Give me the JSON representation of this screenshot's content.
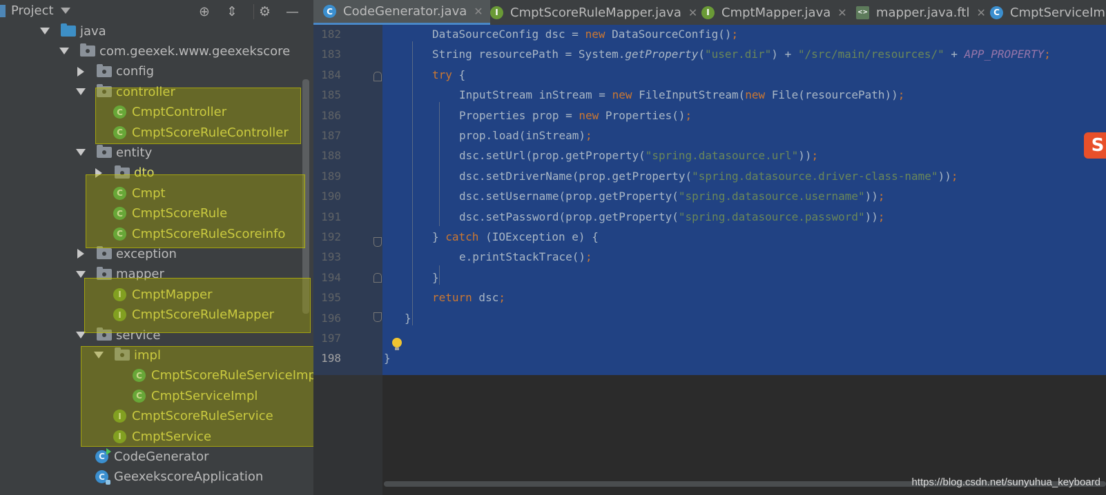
{
  "project": {
    "title": "Project",
    "toolbar_icons": [
      "target-icon",
      "collapse-icon",
      "gear-icon",
      "minimize-icon"
    ]
  },
  "tree": [
    {
      "label": "java",
      "level": 1,
      "kind": "folder-blue",
      "expanded": true
    },
    {
      "label": "com.geexek.www.geexekscore",
      "level": 2,
      "kind": "package",
      "expanded": true
    },
    {
      "label": "config",
      "level": 3,
      "kind": "package",
      "expanded": false
    },
    {
      "label": "controller",
      "level": 3,
      "kind": "package",
      "expanded": true,
      "hl": true
    },
    {
      "label": "CmptController",
      "level": 4,
      "kind": "class",
      "hl": true
    },
    {
      "label": "CmptScoreRuleController",
      "level": 4,
      "kind": "class",
      "hl": true
    },
    {
      "label": "entity",
      "level": 3,
      "kind": "package",
      "expanded": true
    },
    {
      "label": "dto",
      "level": 4,
      "kind": "package",
      "expanded": false,
      "hl": true
    },
    {
      "label": "Cmpt",
      "level": 4,
      "kind": "class",
      "hl": true
    },
    {
      "label": "CmptScoreRule",
      "level": 4,
      "kind": "class",
      "hl": true
    },
    {
      "label": "CmptScoreRuleScoreinfo",
      "level": 4,
      "kind": "class",
      "hl": true
    },
    {
      "label": "exception",
      "level": 3,
      "kind": "package",
      "expanded": false
    },
    {
      "label": "mapper",
      "level": 3,
      "kind": "package",
      "expanded": true
    },
    {
      "label": "CmptMapper",
      "level": 4,
      "kind": "interface",
      "hl": true
    },
    {
      "label": "CmptScoreRuleMapper",
      "level": 4,
      "kind": "interface",
      "hl": true
    },
    {
      "label": "service",
      "level": 3,
      "kind": "package",
      "expanded": true
    },
    {
      "label": "impl",
      "level": 4,
      "kind": "package",
      "expanded": true,
      "hl": true
    },
    {
      "label": "CmptScoreRuleServiceImpl",
      "level": 5,
      "kind": "class",
      "hl": true
    },
    {
      "label": "CmptServiceImpl",
      "level": 5,
      "kind": "class",
      "hl": true
    },
    {
      "label": "CmptScoreRuleService",
      "level": 4,
      "kind": "interface",
      "hl": true
    },
    {
      "label": "CmptService",
      "level": 4,
      "kind": "interface",
      "hl": true
    },
    {
      "label": "CodeGenerator",
      "level": 3,
      "kind": "class-run"
    },
    {
      "label": "GeexekscoreApplication",
      "level": 3,
      "kind": "class-app"
    }
  ],
  "tabs": [
    {
      "label": "CodeGenerator.java",
      "icon": "C",
      "active": true
    },
    {
      "label": "CmptScoreRuleMapper.java",
      "icon": "I",
      "active": false
    },
    {
      "label": "CmptMapper.java",
      "icon": "I",
      "active": false
    },
    {
      "label": "mapper.java.ftl",
      "icon": "<>",
      "active": false
    },
    {
      "label": "CmptServiceIm",
      "icon": "C",
      "active": false
    }
  ],
  "tab_close": "✕",
  "code_lines": [
    {
      "n": "182",
      "indent": 2,
      "tokens": [
        [
          "DataSourceConfig dsc = ",
          ""
        ],
        [
          "new",
          "k"
        ],
        [
          " DataSourceConfig()",
          ""
        ],
        [
          ";",
          "k"
        ]
      ]
    },
    {
      "n": "183",
      "indent": 2,
      "tokens": [
        [
          "String resourcePath = System.",
          ""
        ],
        [
          "getProperty",
          "it"
        ],
        [
          "(",
          ""
        ],
        [
          "\"user.dir\"",
          "s"
        ],
        [
          ") + ",
          ""
        ],
        [
          "\"/src/main/resources/\"",
          "s"
        ],
        [
          " + ",
          ""
        ],
        [
          "APP_PROPERTY",
          "const"
        ],
        [
          ";",
          "k"
        ]
      ]
    },
    {
      "n": "184",
      "indent": 2,
      "tokens": [
        [
          "try",
          "k"
        ],
        [
          " {",
          ""
        ]
      ]
    },
    {
      "n": "185",
      "indent": 3,
      "tokens": [
        [
          "InputStream inStream = ",
          ""
        ],
        [
          "new",
          "k"
        ],
        [
          " FileInputStream(",
          ""
        ],
        [
          "new",
          "k"
        ],
        [
          " File(resourcePath))",
          ""
        ],
        [
          ";",
          "k"
        ]
      ]
    },
    {
      "n": "186",
      "indent": 3,
      "tokens": [
        [
          "Properties prop = ",
          ""
        ],
        [
          "new",
          "k"
        ],
        [
          " Properties()",
          ""
        ],
        [
          ";",
          "k"
        ]
      ]
    },
    {
      "n": "187",
      "indent": 3,
      "tokens": [
        [
          "prop.load(inStream)",
          ""
        ],
        [
          ";",
          "k"
        ]
      ]
    },
    {
      "n": "188",
      "indent": 3,
      "tokens": [
        [
          "dsc.setUrl(prop.getProperty(",
          ""
        ],
        [
          "\"spring.datasource.url\"",
          "s"
        ],
        [
          "))",
          ""
        ],
        [
          ";",
          "k"
        ]
      ]
    },
    {
      "n": "189",
      "indent": 3,
      "tokens": [
        [
          "dsc.setDriverName(prop.getProperty(",
          ""
        ],
        [
          "\"spring.datasource.driver-class-name\"",
          "s"
        ],
        [
          "))",
          ""
        ],
        [
          ";",
          "k"
        ]
      ]
    },
    {
      "n": "190",
      "indent": 3,
      "tokens": [
        [
          "dsc.setUsername(prop.getProperty(",
          ""
        ],
        [
          "\"spring.datasource.username\"",
          "s"
        ],
        [
          "))",
          ""
        ],
        [
          ";",
          "k"
        ]
      ]
    },
    {
      "n": "191",
      "indent": 3,
      "tokens": [
        [
          "dsc.setPassword(prop.getProperty(",
          ""
        ],
        [
          "\"spring.datasource.password\"",
          "s"
        ],
        [
          "))",
          ""
        ],
        [
          ";",
          "k"
        ]
      ]
    },
    {
      "n": "192",
      "indent": 2,
      "tokens": [
        [
          "} ",
          ""
        ],
        [
          "catch",
          "k"
        ],
        [
          " (IOException e) {",
          ""
        ]
      ]
    },
    {
      "n": "193",
      "indent": 3,
      "tokens": [
        [
          "e.printStackTrace()",
          ""
        ],
        [
          ";",
          "k"
        ]
      ]
    },
    {
      "n": "194",
      "indent": 2,
      "tokens": [
        [
          "}",
          ""
        ]
      ]
    },
    {
      "n": "195",
      "indent": 2,
      "tokens": [
        [
          "return",
          "k"
        ],
        [
          " dsc",
          ""
        ],
        [
          ";",
          "k"
        ]
      ]
    },
    {
      "n": "196",
      "indent": 1,
      "tokens": [
        [
          "}",
          ""
        ]
      ]
    },
    {
      "n": "197",
      "indent": 0,
      "tokens": []
    },
    {
      "n": "198",
      "indent": 0,
      "tokens": [
        [
          "}",
          ""
        ]
      ]
    }
  ],
  "current_line": "198",
  "watermark": "https://blog.csdn.net/sunyuhua_keyboard",
  "logo_text": "S"
}
